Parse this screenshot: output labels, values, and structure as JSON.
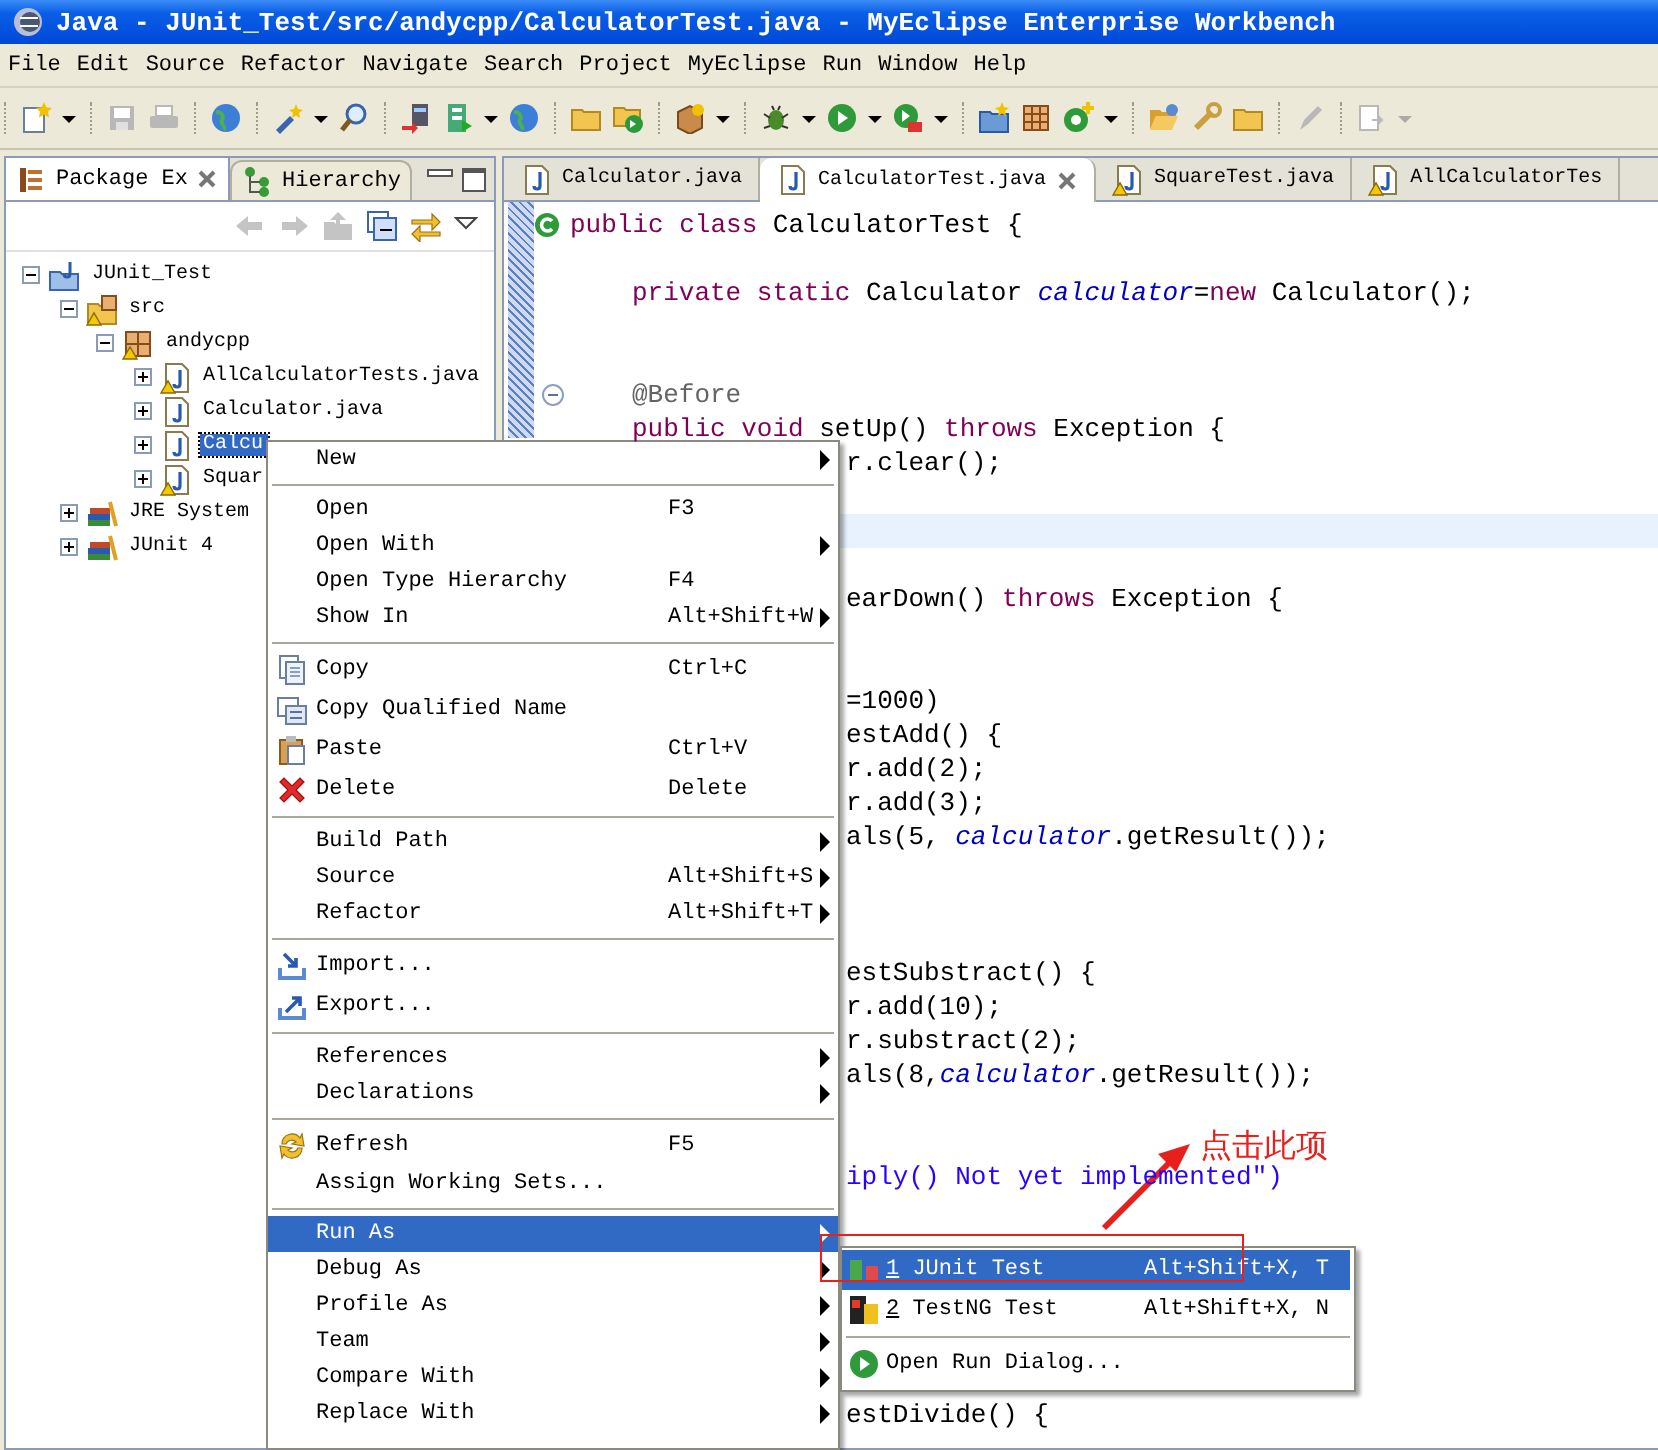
{
  "window": {
    "title": "Java - JUnit_Test/src/andycpp/CalculatorTest.java - MyEclipse Enterprise Workbench"
  },
  "menu_bar": [
    "File",
    "Edit",
    "Source",
    "Refactor",
    "Navigate",
    "Search",
    "Project",
    "MyEclipse",
    "Run",
    "Window",
    "Help"
  ],
  "toolbar": [
    {
      "items": [
        {
          "kind": "new",
          "disabled": false,
          "dropdown": true
        }
      ]
    },
    {
      "items": [
        {
          "kind": "save",
          "disabled": true,
          "dropdown": false
        },
        {
          "kind": "print",
          "disabled": true,
          "dropdown": false
        }
      ]
    },
    {
      "items": [
        {
          "kind": "globe",
          "disabled": false,
          "dropdown": false
        }
      ]
    },
    {
      "items": [
        {
          "kind": "wand",
          "disabled": false,
          "dropdown": true
        },
        {
          "kind": "magnifier",
          "disabled": false,
          "dropdown": false
        }
      ]
    },
    {
      "items": [
        {
          "kind": "deploy",
          "disabled": false,
          "dropdown": false
        },
        {
          "kind": "server",
          "disabled": false,
          "dropdown": true
        },
        {
          "kind": "globe",
          "disabled": false,
          "dropdown": false
        }
      ]
    },
    {
      "items": [
        {
          "kind": "folder",
          "disabled": false,
          "dropdown": false
        },
        {
          "kind": "folder-go",
          "disabled": false,
          "dropdown": false
        }
      ]
    },
    {
      "items": [
        {
          "kind": "box",
          "disabled": false,
          "dropdown": true
        }
      ]
    },
    {
      "items": [
        {
          "kind": "bug",
          "disabled": false,
          "dropdown": true
        },
        {
          "kind": "run",
          "disabled": false,
          "dropdown": true
        },
        {
          "kind": "run-tool",
          "disabled": false,
          "dropdown": true
        }
      ]
    },
    {
      "items": [
        {
          "kind": "new-folder",
          "disabled": false,
          "dropdown": false
        },
        {
          "kind": "grid",
          "disabled": false,
          "dropdown": false
        },
        {
          "kind": "new-class",
          "disabled": false,
          "dropdown": true
        }
      ]
    },
    {
      "items": [
        {
          "kind": "folder-open",
          "disabled": false,
          "dropdown": false
        },
        {
          "kind": "wrench",
          "disabled": false,
          "dropdown": false
        },
        {
          "kind": "folder",
          "disabled": false,
          "dropdown": false
        }
      ]
    },
    {
      "items": [
        {
          "kind": "pen",
          "disabled": true,
          "dropdown": false
        }
      ]
    },
    {
      "items": [
        {
          "kind": "nav",
          "disabled": true,
          "dropdown": true
        }
      ]
    }
  ],
  "explorer": {
    "tabs": [
      {
        "label": "Package Ex",
        "selected": true
      },
      {
        "label": "Hierarchy",
        "selected": false
      }
    ],
    "view_toolbar": [
      {
        "kind": "back",
        "disabled": true
      },
      {
        "kind": "forward",
        "disabled": true
      },
      {
        "kind": "up",
        "disabled": true
      },
      {
        "kind": "collapse",
        "disabled": false
      },
      {
        "kind": "link",
        "disabled": false
      },
      {
        "kind": "view-menu",
        "disabled": false
      }
    ],
    "tree": [
      {
        "label": "JUnit_Test",
        "kind": "project",
        "warning": false,
        "expanded": true,
        "selected": false,
        "children": [
          {
            "label": "src",
            "kind": "source-folder",
            "warning": true,
            "expanded": true,
            "selected": false,
            "children": [
              {
                "label": "andycpp",
                "kind": "package",
                "warning": true,
                "expanded": true,
                "selected": false,
                "children": [
                  {
                    "label": "AllCalculatorTests.java",
                    "kind": "java-file",
                    "warning": true,
                    "expanded": false,
                    "selected": false
                  },
                  {
                    "label": "Calculator.java",
                    "kind": "java-file",
                    "warning": false,
                    "expanded": false,
                    "selected": false
                  },
                  {
                    "label": "Calcu",
                    "kind": "java-file",
                    "warning": false,
                    "expanded": false,
                    "selected": true
                  },
                  {
                    "label": "Squar",
                    "kind": "java-file",
                    "warning": true,
                    "expanded": false,
                    "selected": false
                  }
                ]
              }
            ]
          },
          {
            "label": "JRE System",
            "kind": "library",
            "warning": false,
            "expanded": false,
            "selected": false
          },
          {
            "label": "JUnit 4",
            "kind": "library",
            "warning": false,
            "expanded": false,
            "selected": false
          }
        ]
      }
    ]
  },
  "editor": {
    "tabs": [
      {
        "label": "Calculator.java",
        "warning": false,
        "selected": false
      },
      {
        "label": "CalculatorTest.java",
        "warning": false,
        "selected": true
      },
      {
        "label": "SquareTest.java",
        "warning": true,
        "selected": false
      },
      {
        "label": "AllCalculatorTes",
        "warning": true,
        "selected": false
      }
    ],
    "lines": [
      {
        "kind": "class-header",
        "parts": [
          {
            "kind": "keyword",
            "text": "public class"
          },
          {
            "kind": "plain",
            "text": " CalculatorTest {"
          }
        ]
      },
      {
        "kind": "blank"
      },
      {
        "kind": "indented",
        "parts": [
          {
            "kind": "keyword",
            "text": "private static"
          },
          {
            "kind": "plain",
            "text": " Calculator "
          },
          {
            "kind": "field",
            "text": "calculator"
          },
          {
            "kind": "plain",
            "text": "="
          },
          {
            "kind": "keyword",
            "text": "new"
          },
          {
            "kind": "plain",
            "text": " Calculator();"
          }
        ]
      },
      {
        "kind": "blank"
      },
      {
        "kind": "blank"
      },
      {
        "kind": "fold-start",
        "parts": [
          {
            "kind": "annotation",
            "text": "@Before"
          }
        ]
      },
      {
        "kind": "indented",
        "parts": [
          {
            "kind": "keyword",
            "text": "public void"
          },
          {
            "kind": "plain",
            "text": " setUp() "
          },
          {
            "kind": "keyword",
            "text": "throws"
          },
          {
            "kind": "plain",
            "text": " Exception {"
          }
        ]
      },
      {
        "kind": "partial",
        "parts": [
          {
            "kind": "plain",
            "text": "r.clear();"
          }
        ]
      },
      {
        "kind": "blank"
      },
      {
        "kind": "current"
      },
      {
        "kind": "blank"
      },
      {
        "kind": "partial",
        "parts": [
          {
            "kind": "plain",
            "text": "earDown() "
          },
          {
            "kind": "keyword",
            "text": "throws"
          },
          {
            "kind": "plain",
            "text": " Exception {"
          }
        ]
      },
      {
        "kind": "blank"
      },
      {
        "kind": "blank"
      },
      {
        "kind": "partial",
        "parts": [
          {
            "kind": "plain",
            "text": "=1000)"
          }
        ]
      },
      {
        "kind": "partial",
        "parts": [
          {
            "kind": "plain",
            "text": "estAdd() {"
          }
        ]
      },
      {
        "kind": "partial",
        "parts": [
          {
            "kind": "plain",
            "text": "r.add(2);"
          }
        ]
      },
      {
        "kind": "partial",
        "parts": [
          {
            "kind": "plain",
            "text": "r.add(3);"
          }
        ]
      },
      {
        "kind": "partial",
        "parts": [
          {
            "kind": "plain",
            "text": "als(5, "
          },
          {
            "kind": "field",
            "text": "calculator"
          },
          {
            "kind": "plain",
            "text": ".getResult());"
          }
        ]
      },
      {
        "kind": "blank"
      },
      {
        "kind": "blank"
      },
      {
        "kind": "blank"
      },
      {
        "kind": "partial",
        "parts": [
          {
            "kind": "plain",
            "text": "estSubstract() {"
          }
        ]
      },
      {
        "kind": "partial",
        "parts": [
          {
            "kind": "plain",
            "text": "r.add(10);"
          }
        ]
      },
      {
        "kind": "partial",
        "parts": [
          {
            "kind": "plain",
            "text": "r.substract(2);"
          }
        ]
      },
      {
        "kind": "partial",
        "parts": [
          {
            "kind": "plain",
            "text": "als(8,"
          },
          {
            "kind": "field",
            "text": "calculator"
          },
          {
            "kind": "plain",
            "text": ".getResult());"
          }
        ]
      },
      {
        "kind": "blank"
      },
      {
        "kind": "blank"
      },
      {
        "kind": "partial",
        "parts": [
          {
            "kind": "string",
            "text": "iply() Not yet implemented\")"
          }
        ]
      },
      {
        "kind": "blank"
      },
      {
        "kind": "blank"
      },
      {
        "kind": "blank"
      },
      {
        "kind": "blank"
      },
      {
        "kind": "blank"
      },
      {
        "kind": "blank"
      },
      {
        "kind": "partial",
        "parts": [
          {
            "kind": "plain",
            "text": "estDivide() {"
          }
        ]
      }
    ]
  },
  "context_menu": {
    "groups": [
      {
        "items": [
          {
            "label": "New",
            "submenu": true,
            "selected": false
          }
        ]
      },
      {
        "items": [
          {
            "label": "Open",
            "shortcut": "F3",
            "submenu": false,
            "selected": false
          },
          {
            "label": "Open With",
            "submenu": true,
            "selected": false
          },
          {
            "label": "Open Type Hierarchy",
            "shortcut": "F4",
            "submenu": false,
            "selected": false
          },
          {
            "label": "Show In",
            "shortcut": "Alt+Shift+W",
            "submenu": true,
            "selected": false
          }
        ]
      },
      {
        "items": [
          {
            "label": "Copy",
            "shortcut": "Ctrl+C",
            "kind": "copy",
            "submenu": false,
            "selected": false
          },
          {
            "label": "Copy Qualified Name",
            "kind": "copy-name",
            "submenu": false,
            "selected": false
          },
          {
            "label": "Paste",
            "shortcut": "Ctrl+V",
            "kind": "paste",
            "submenu": false,
            "selected": false
          },
          {
            "label": "Delete",
            "shortcut": "Delete",
            "kind": "delete",
            "submenu": false,
            "selected": false
          }
        ]
      },
      {
        "items": [
          {
            "label": "Build Path",
            "submenu": true,
            "selected": false
          },
          {
            "label": "Source",
            "shortcut": "Alt+Shift+S",
            "submenu": true,
            "selected": false
          },
          {
            "label": "Refactor",
            "shortcut": "Alt+Shift+T",
            "submenu": true,
            "selected": false
          }
        ]
      },
      {
        "items": [
          {
            "label": "Import...",
            "kind": "import",
            "submenu": false,
            "selected": false
          },
          {
            "label": "Export...",
            "kind": "export",
            "submenu": false,
            "selected": false
          }
        ]
      },
      {
        "items": [
          {
            "label": "References",
            "submenu": true,
            "selected": false
          },
          {
            "label": "Declarations",
            "submenu": true,
            "selected": false
          }
        ]
      },
      {
        "items": [
          {
            "label": "Refresh",
            "shortcut": "F5",
            "kind": "refresh",
            "submenu": false,
            "selected": false
          },
          {
            "label": "Assign Working Sets...",
            "submenu": false,
            "selected": false
          }
        ]
      },
      {
        "items": [
          {
            "label": "Run As",
            "submenu": true,
            "selected": true
          },
          {
            "label": "Debug As",
            "submenu": true,
            "selected": false
          },
          {
            "label": "Profile As",
            "submenu": true,
            "selected": false
          },
          {
            "label": "Team",
            "submenu": true,
            "selected": false
          },
          {
            "label": "Compare With",
            "submenu": true,
            "selected": false
          },
          {
            "label": "Replace With",
            "submenu": true,
            "selected": false
          }
        ]
      }
    ]
  },
  "run_submenu": {
    "groups": [
      {
        "items": [
          {
            "number": "1",
            "label": "JUnit Test",
            "shortcut": "Alt+Shift+X, T",
            "kind": "junit",
            "selected": true
          },
          {
            "number": "2",
            "label": "TestNG Test",
            "shortcut": "Alt+Shift+X, N",
            "kind": "testng",
            "selected": false
          }
        ]
      },
      {
        "items": [
          {
            "label": "Open Run Dialog...",
            "kind": "run",
            "selected": false
          }
        ]
      }
    ]
  },
  "annotation": {
    "text": "点击此项"
  }
}
